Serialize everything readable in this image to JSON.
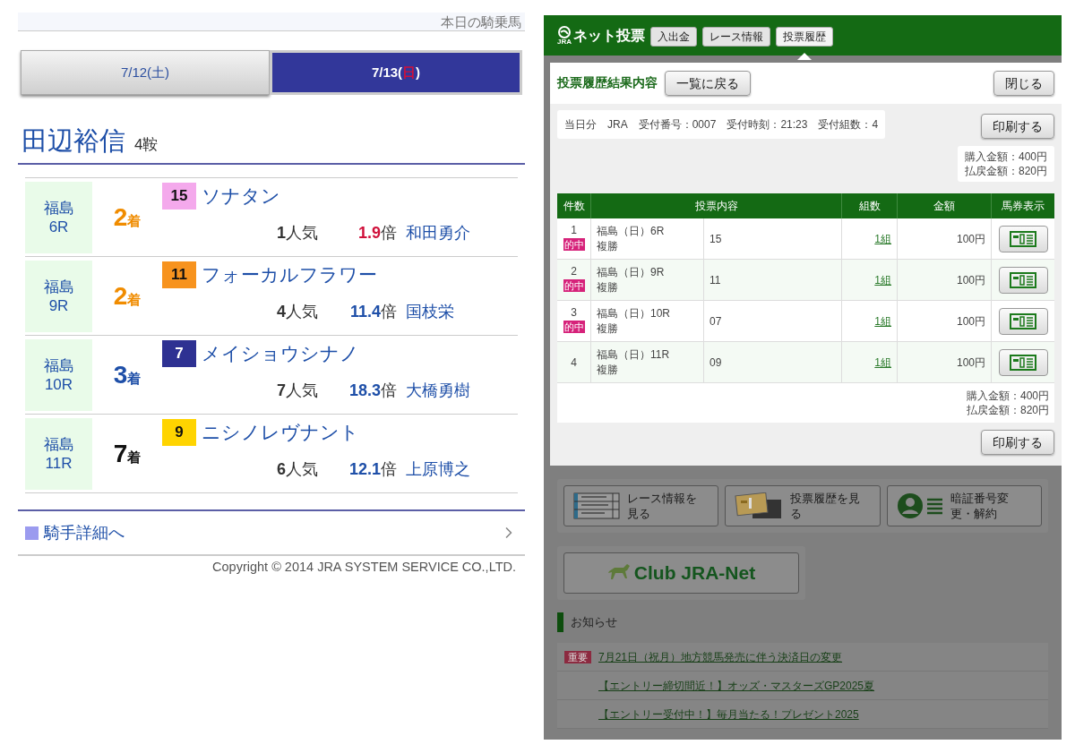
{
  "left": {
    "header": "本日の騎乗馬",
    "date_tabs": [
      {
        "before": "7/12(",
        "weekday": "土",
        "after": ")",
        "weekday_red": false,
        "selected": false
      },
      {
        "before": "7/13(",
        "weekday": "日",
        "after": ")",
        "weekday_red": true,
        "selected": true
      }
    ],
    "jockey": {
      "name": "田辺裕信",
      "mounts": "4鞍"
    },
    "races": [
      {
        "venue": "福島",
        "race": "6R",
        "place": "2",
        "place_suffix": "着",
        "kind": "second",
        "number": "15",
        "color": "#f4a9ec",
        "horse": "ソナタン",
        "popularity": "1",
        "popularity_suffix": "人気",
        "odds": "1.9",
        "odds_suffix": "倍",
        "odds_highlight": true,
        "rider": "和田勇介"
      },
      {
        "venue": "福島",
        "race": "9R",
        "place": "2",
        "place_suffix": "着",
        "kind": "second",
        "number": "11",
        "color": "#f7931e",
        "horse": "フォーカルフラワー",
        "popularity": "4",
        "popularity_suffix": "人気",
        "odds": "11.4",
        "odds_suffix": "倍",
        "odds_highlight": false,
        "rider": "国枝栄"
      },
      {
        "venue": "福島",
        "race": "10R",
        "place": "3",
        "place_suffix": "着",
        "kind": "third",
        "number": "7",
        "color": "#2e3192",
        "horse": "メイショウシナノ",
        "popularity": "7",
        "popularity_suffix": "人気",
        "odds": "18.3",
        "odds_suffix": "倍",
        "odds_highlight": false,
        "rider": "大橋勇樹"
      },
      {
        "venue": "福島",
        "race": "11R",
        "place": "7",
        "place_suffix": "着",
        "kind": "unplaced",
        "number": "9",
        "color": "#ffd400",
        "horse": "ニシノレヴナント",
        "popularity": "6",
        "popularity_suffix": "人気",
        "odds": "12.1",
        "odds_suffix": "倍",
        "odds_highlight": false,
        "rider": "上原博之"
      }
    ],
    "detail_link": "騎手詳細へ",
    "copyright": "Copyright © 2014 JRA SYSTEM SERVICE CO.,LTD."
  },
  "right": {
    "logo_small": "JRA",
    "logo": "ネット投票",
    "nav": [
      {
        "label": "入出金",
        "selected": false
      },
      {
        "label": "レース情報",
        "selected": false
      },
      {
        "label": "投票履歴",
        "selected": true
      }
    ],
    "modal": {
      "title": "投票履歴結果内容",
      "back": "一覧に戻る",
      "close": "閉じる",
      "info": [
        "当日分",
        "JRA",
        "受付番号：0007",
        "受付時刻：21:23",
        "受付組数：4"
      ],
      "print": "印刷する",
      "totals": [
        "購入金額：400円",
        "払戻金額：820円"
      ],
      "columns": [
        "件数",
        "投票内容",
        "組数",
        "金額",
        "馬券表示"
      ],
      "rows": [
        {
          "no": "1",
          "hit": true,
          "hit_label": "的中",
          "race": "福島（日）6R",
          "bet_type": "複勝",
          "selection": "15",
          "count": "1組",
          "amount": "100円"
        },
        {
          "no": "2",
          "hit": true,
          "hit_label": "的中",
          "race": "福島（日）9R",
          "bet_type": "複勝",
          "selection": "11",
          "count": "1組",
          "amount": "100円"
        },
        {
          "no": "3",
          "hit": true,
          "hit_label": "的中",
          "race": "福島（日）10R",
          "bet_type": "複勝",
          "selection": "07",
          "count": "1組",
          "amount": "100円"
        },
        {
          "no": "4",
          "hit": false,
          "race": "福島（日）11R",
          "bet_type": "複勝",
          "selection": "09",
          "count": "1組",
          "amount": "100円"
        }
      ],
      "totals_bottom": [
        "購入金額：400円",
        "払戻金額：820円"
      ],
      "print_bottom": "印刷する"
    },
    "menu": [
      {
        "kind": "race",
        "label": "レース情報を見る"
      },
      {
        "kind": "history",
        "label": "投票履歴を見る"
      },
      {
        "kind": "account",
        "label": "暗証番号変更・解約"
      }
    ],
    "club": "Club JRA-Net",
    "notices": {
      "title": "お知らせ",
      "items": [
        {
          "badge": "重要",
          "text": "7月21日（祝月）地方競馬発売に伴う決済日の変更"
        },
        {
          "text": "【エントリー締切間近！】オッズ・マスターズGP2025夏"
        },
        {
          "text": "【エントリー受付中！】毎月当たる！プレゼント2025"
        }
      ]
    }
  }
}
